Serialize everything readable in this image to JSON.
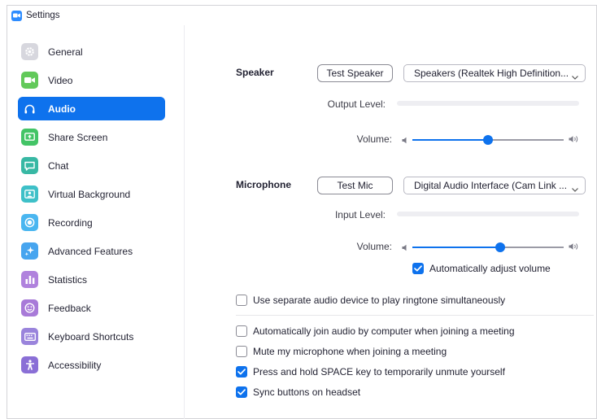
{
  "window": {
    "title": "Settings"
  },
  "accent": "#0e72ed",
  "sidebar": {
    "items": [
      {
        "label": "General",
        "icon": "gear-icon",
        "color": "#d7d7de",
        "active": false
      },
      {
        "label": "Video",
        "icon": "video-camera-icon",
        "color": "#62c95a",
        "active": false
      },
      {
        "label": "Audio",
        "icon": "headphones-icon",
        "color": "#0e72ed",
        "active": true
      },
      {
        "label": "Share Screen",
        "icon": "share-screen-icon",
        "color": "#43c466",
        "active": false
      },
      {
        "label": "Chat",
        "icon": "chat-bubble-icon",
        "color": "#38b8a4",
        "active": false
      },
      {
        "label": "Virtual Background",
        "icon": "person-background-icon",
        "color": "#3ec0c8",
        "active": false
      },
      {
        "label": "Recording",
        "icon": "record-icon",
        "color": "#4ab6f0",
        "active": false
      },
      {
        "label": "Advanced Features",
        "icon": "sparkle-icon",
        "color": "#47a5ef",
        "active": false
      },
      {
        "label": "Statistics",
        "icon": "bar-chart-icon",
        "color": "#b082dd",
        "active": false
      },
      {
        "label": "Feedback",
        "icon": "smiley-icon",
        "color": "#a87ad8",
        "active": false
      },
      {
        "label": "Keyboard Shortcuts",
        "icon": "keyboard-icon",
        "color": "#9a84dc",
        "active": false
      },
      {
        "label": "Accessibility",
        "icon": "accessibility-icon",
        "color": "#8a6fd6",
        "active": false
      }
    ]
  },
  "speaker": {
    "section_label": "Speaker",
    "test_button": "Test Speaker",
    "device": "Speakers (Realtek High Definition...",
    "output_label": "Output Level:",
    "volume_label": "Volume:",
    "volume": 0.5
  },
  "microphone": {
    "section_label": "Microphone",
    "test_button": "Test Mic",
    "device": "Digital Audio Interface (Cam Link ...",
    "input_label": "Input Level:",
    "volume_label": "Volume:",
    "volume": 0.58,
    "auto_adjust": {
      "label": "Automatically adjust volume",
      "checked": true
    }
  },
  "options": {
    "ringtone": {
      "label": "Use separate audio device to play ringtone simultaneously",
      "checked": false
    },
    "list": [
      {
        "label": "Automatically join audio by computer when joining a meeting",
        "checked": false
      },
      {
        "label": "Mute my microphone when joining a meeting",
        "checked": false
      },
      {
        "label": "Press and hold SPACE key to temporarily unmute yourself",
        "checked": true
      },
      {
        "label": "Sync buttons on headset",
        "checked": true
      }
    ]
  }
}
